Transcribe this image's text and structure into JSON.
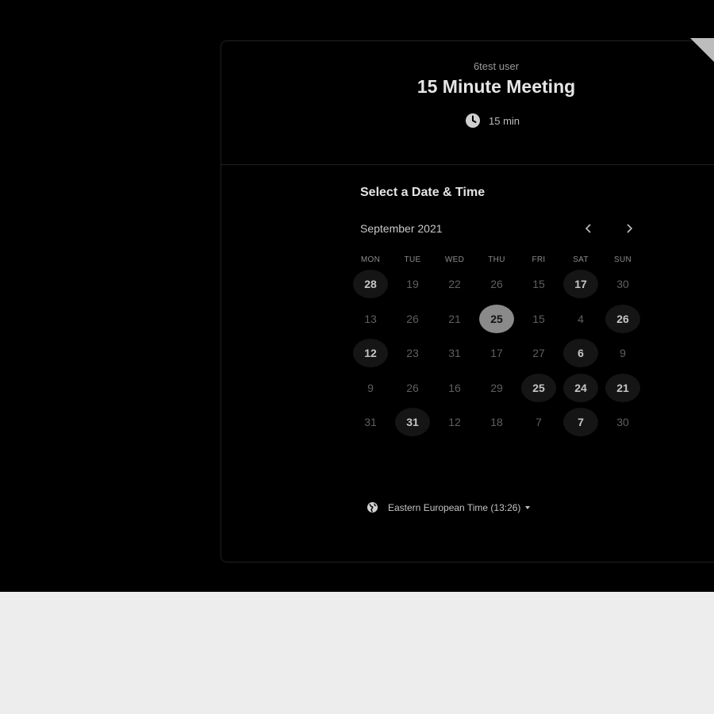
{
  "event": {
    "owner": "6test user",
    "title": "15 Minute Meeting",
    "duration": "15 min"
  },
  "calendar": {
    "section_title": "Select a Date & Time",
    "month_label": "September 2021",
    "prev_icon": "chevron-left-icon",
    "next_icon": "chevron-right-icon",
    "weekdays": [
      "MON",
      "TUE",
      "WED",
      "THU",
      "FRI",
      "SAT",
      "SUN"
    ],
    "weeks": [
      [
        {
          "d": "28",
          "s": "avail"
        },
        {
          "d": "19",
          "s": "off"
        },
        {
          "d": "22",
          "s": "off"
        },
        {
          "d": "26",
          "s": "off"
        },
        {
          "d": "15",
          "s": "off"
        },
        {
          "d": "17",
          "s": "avail"
        },
        {
          "d": "30",
          "s": "off"
        }
      ],
      [
        {
          "d": "13",
          "s": "off"
        },
        {
          "d": "26",
          "s": "off"
        },
        {
          "d": "21",
          "s": "off"
        },
        {
          "d": "25",
          "s": "selected"
        },
        {
          "d": "15",
          "s": "off"
        },
        {
          "d": "4",
          "s": "off"
        },
        {
          "d": "26",
          "s": "avail"
        }
      ],
      [
        {
          "d": "12",
          "s": "avail"
        },
        {
          "d": "23",
          "s": "off"
        },
        {
          "d": "31",
          "s": "off"
        },
        {
          "d": "17",
          "s": "off"
        },
        {
          "d": "27",
          "s": "off"
        },
        {
          "d": "6",
          "s": "avail"
        },
        {
          "d": "9",
          "s": "off"
        }
      ],
      [
        {
          "d": "9",
          "s": "off"
        },
        {
          "d": "26",
          "s": "off"
        },
        {
          "d": "16",
          "s": "off"
        },
        {
          "d": "29",
          "s": "off"
        },
        {
          "d": "25",
          "s": "avail"
        },
        {
          "d": "24",
          "s": "avail"
        },
        {
          "d": "21",
          "s": "avail"
        }
      ],
      [
        {
          "d": "31",
          "s": "off"
        },
        {
          "d": "31",
          "s": "avail"
        },
        {
          "d": "12",
          "s": "off"
        },
        {
          "d": "18",
          "s": "off"
        },
        {
          "d": "7",
          "s": "off"
        },
        {
          "d": "7",
          "s": "avail"
        },
        {
          "d": "30",
          "s": "off"
        }
      ]
    ]
  },
  "timezone": {
    "label": "Eastern European Time (13:26)",
    "icon": "globe-icon"
  },
  "colors": {
    "backdrop": "#000000",
    "page_bottom": "#ededed",
    "selected_day": "#8a8a8a",
    "available_day": "#151515"
  }
}
